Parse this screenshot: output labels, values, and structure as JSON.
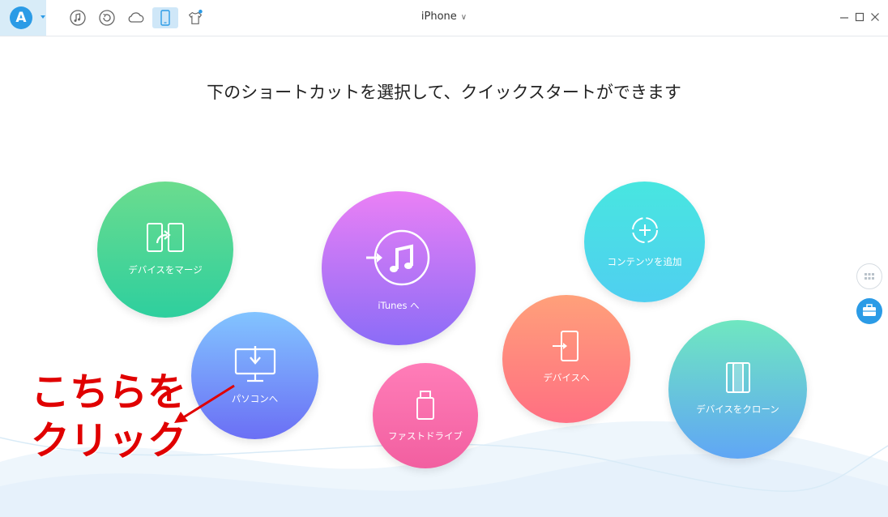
{
  "titlebar": {
    "device_name": "iPhone",
    "chevron": "∨",
    "icons": [
      "music-icon",
      "backup-restore-icon",
      "cloud-icon",
      "phone-icon",
      "tshirt-icon"
    ],
    "window_controls": [
      "minimize-icon",
      "maximize-icon",
      "close-icon"
    ]
  },
  "heading": "下のショートカットを選択して、クイックスタートができます",
  "shortcuts": {
    "merge": "デバイスをマージ",
    "itunes": "iTunes へ",
    "add_content": "コンテンツを追加",
    "to_pc": "パソコンへ",
    "fast_drive": "ファストドライブ",
    "to_device": "デバイスへ",
    "clone": "デバイスをクローン"
  },
  "annotation": {
    "line1": "こちらを",
    "line2": "クリック",
    "color": "#e00000"
  },
  "colors": {
    "accent": "#2b9be6",
    "merge": [
      "#6bdc8e",
      "#2ecf9e"
    ],
    "itunes": [
      "#ea80f5",
      "#8b6cf7"
    ],
    "add_content": [
      "#48e6e0",
      "#4fcff0"
    ],
    "to_pc": [
      "#82c4ff",
      "#6b6ff5"
    ],
    "fast_drive": [
      "#ff7db8",
      "#f25fa0"
    ],
    "to_device": [
      "#ffa07a",
      "#ff6f82"
    ],
    "clone": [
      "#6fe7c0",
      "#60a6f5"
    ]
  }
}
